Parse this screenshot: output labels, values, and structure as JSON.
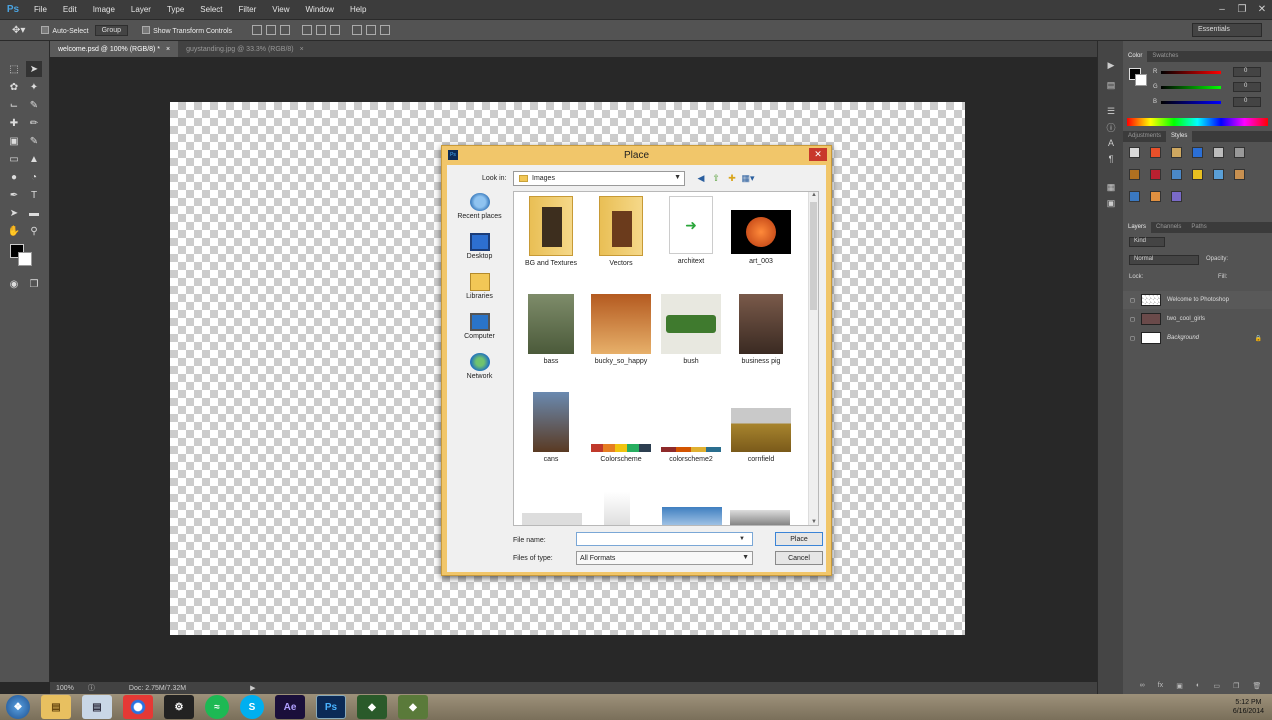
{
  "app": {
    "logo": "Ps"
  },
  "menu": [
    "File",
    "Edit",
    "Image",
    "Layer",
    "Type",
    "Select",
    "Filter",
    "View",
    "Window",
    "Help"
  ],
  "options": {
    "auto_select_label": "Auto-Select",
    "group_value": "Group",
    "show_transform_label": "Show Transform Controls",
    "workspace": "Essentials"
  },
  "tabs": [
    {
      "label": "welcome.psd @ 100% (RGB/8) *"
    },
    {
      "label": "guystanding.jpg @ 33.3% (RGB/8)"
    }
  ],
  "status": {
    "zoom": "100%",
    "doc": "Doc: 2.75M/7.32M"
  },
  "panels": {
    "color_tabs": [
      "Color",
      "Swatches"
    ],
    "color_values": [
      "0",
      "0",
      "0"
    ],
    "color_letters": [
      "R",
      "G",
      "B"
    ],
    "styles_tabs": [
      "Adjustments",
      "Styles"
    ],
    "layers_tabs": [
      "Layers",
      "Channels",
      "Paths"
    ],
    "kind_label": "Kind",
    "blend_mode": "Normal",
    "opacity_label": "Opacity:",
    "fill_label": "Fill:",
    "lock_label": "Lock:",
    "layers": [
      {
        "name": "Welcome to Photoshop"
      },
      {
        "name": "two_cool_girls"
      },
      {
        "name": "Background"
      }
    ]
  },
  "dialog": {
    "title": "Place",
    "lookin_label": "Look in:",
    "lookin_value": "Images",
    "places": [
      {
        "label": "Recent places"
      },
      {
        "label": "Desktop"
      },
      {
        "label": "Libraries"
      },
      {
        "label": "Computer"
      },
      {
        "label": "Network"
      }
    ],
    "files": [
      {
        "name": "BG and Textures"
      },
      {
        "name": "Vectors"
      },
      {
        "name": "architext"
      },
      {
        "name": "art_003"
      },
      {
        "name": "bass"
      },
      {
        "name": "bucky_so_happy"
      },
      {
        "name": "bush"
      },
      {
        "name": "business pig"
      },
      {
        "name": "cans"
      },
      {
        "name": "Colorscheme"
      },
      {
        "name": "colorscheme2"
      },
      {
        "name": "cornfield"
      }
    ],
    "file_name_label": "File name:",
    "file_name_value": "",
    "file_type_label": "Files of type:",
    "file_type_value": "All Formats",
    "place_button": "Place",
    "cancel_button": "Cancel"
  },
  "taskbar": {
    "time": "5:12 PM",
    "date": "6/16/2014"
  }
}
